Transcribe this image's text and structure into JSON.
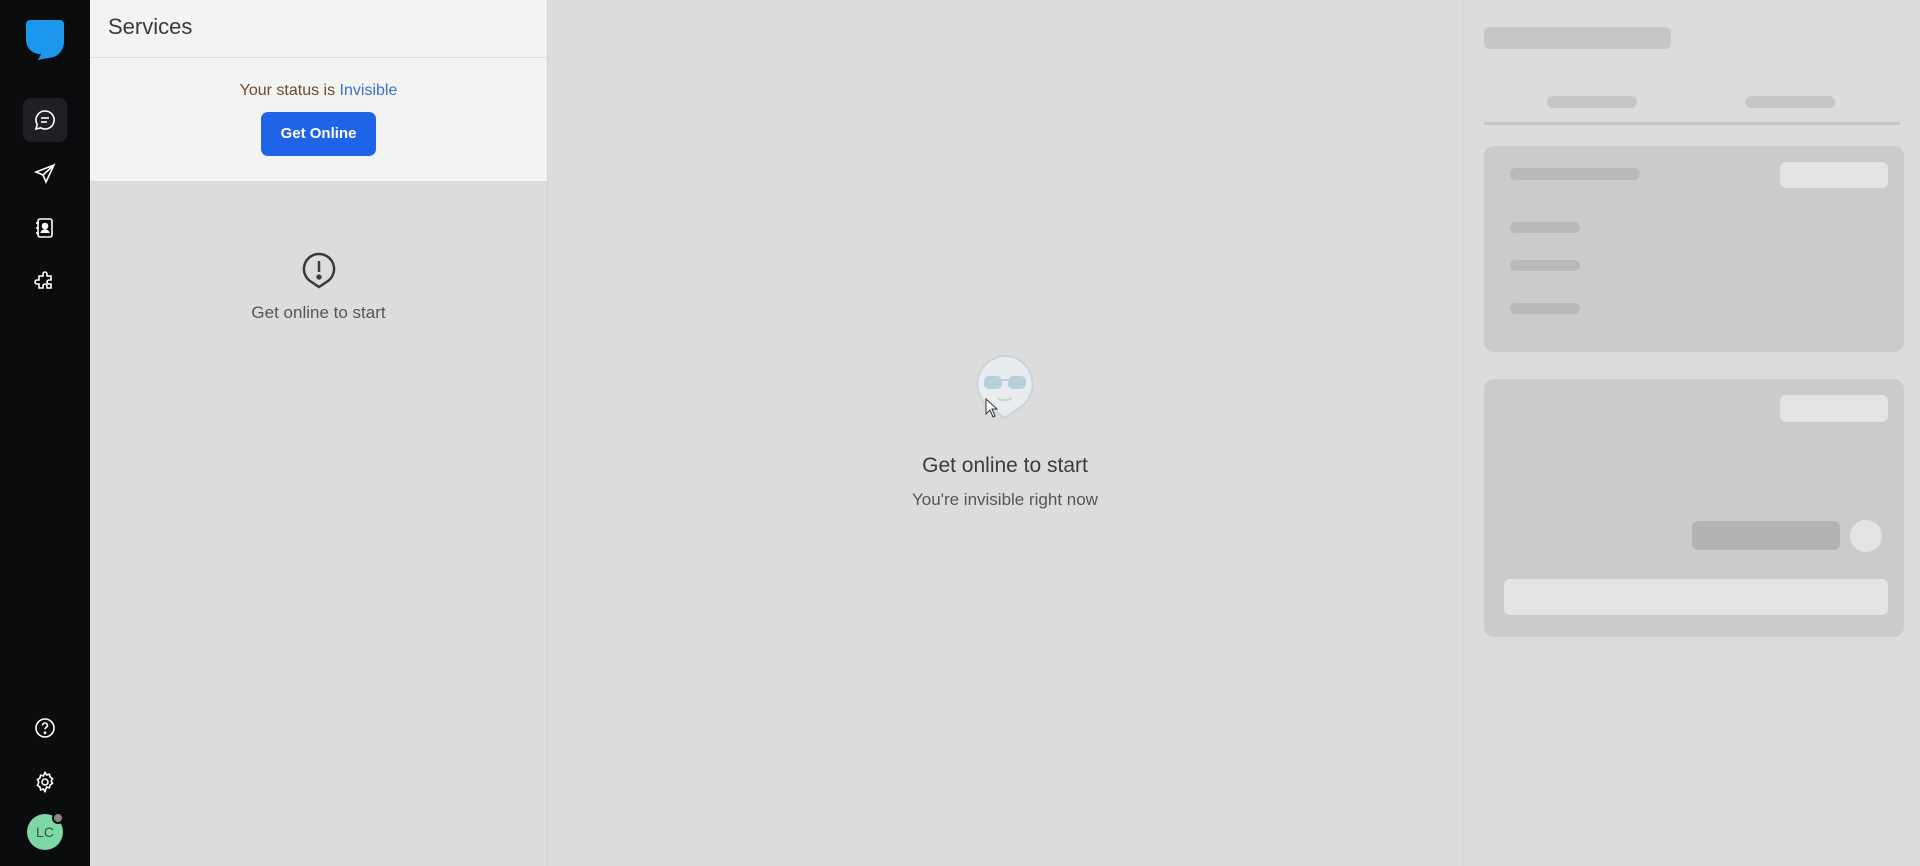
{
  "rail": {
    "items": [
      {
        "name": "chats",
        "icon": "chat-bubble-icon",
        "active": true
      },
      {
        "name": "campaigns",
        "icon": "paper-plane-icon",
        "active": false
      },
      {
        "name": "contacts",
        "icon": "contact-book-icon",
        "active": false
      },
      {
        "name": "integrations",
        "icon": "puzzle-icon",
        "active": false
      }
    ],
    "bottom": [
      {
        "name": "help",
        "icon": "help-circle-icon"
      },
      {
        "name": "settings",
        "icon": "gear-icon"
      }
    ],
    "avatar_initials": "LC"
  },
  "services": {
    "title": "Services",
    "status_prefix": "Your status is",
    "status_value": "Invisible",
    "get_online_label": "Get Online",
    "empty_text": "Get online to start"
  },
  "center": {
    "title": "Get online to start",
    "subtitle": "You're invisible right now"
  },
  "colors": {
    "accent": "#1f64e6",
    "status_invisible": "#3a6fd0",
    "rail_bg": "#0b0c0e",
    "logo": "#1c97ee",
    "avatar": "#7ed8a6"
  }
}
